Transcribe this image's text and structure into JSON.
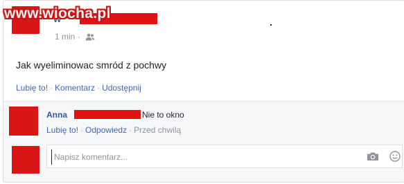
{
  "watermark": {
    "text": "www.wiocha.pl"
  },
  "post": {
    "author_visible": "W",
    "time": "1 min",
    "meta_sep": "·",
    "privacy_icon": "friends-icon",
    "text": "Jak wyeliminowac smród z pochwy",
    "actions": {
      "like": "Lubię to!",
      "comment": "Komentarz",
      "share": "Udostępnij",
      "sep": "·"
    }
  },
  "comment": {
    "author": "Anna",
    "text": "Nie to okno",
    "like": "Lubię to!",
    "reply": "Odpowiedz",
    "time": "Przed chwilą",
    "sep": "·"
  },
  "composer": {
    "placeholder": "Napisz komentarz...",
    "camera_icon": "camera-icon",
    "emoji_icon": "emoji-icon"
  },
  "colors": {
    "link": "#4267b2",
    "author": "#365899",
    "muted": "#90949c",
    "text": "#1d2129",
    "redaction": "#e31212",
    "comment_bg": "#f6f7f9",
    "border": "#dddfe2"
  }
}
